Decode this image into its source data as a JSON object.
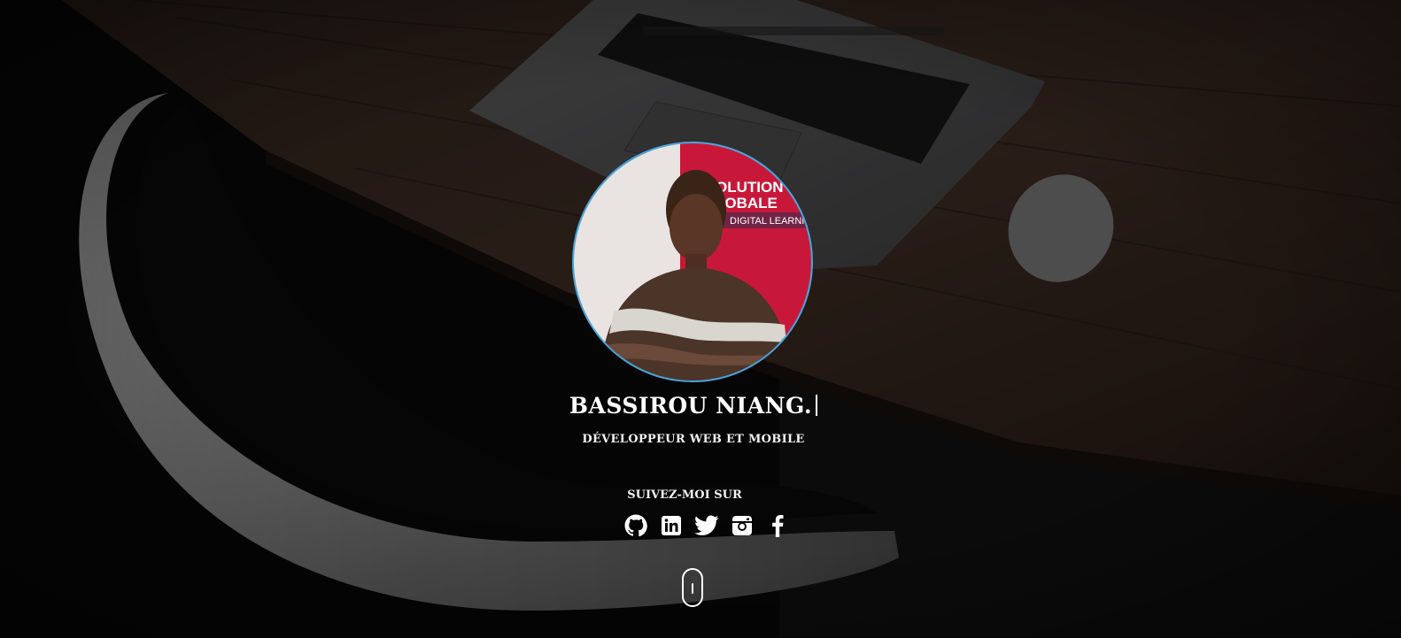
{
  "hero": {
    "name": "BASSIROU NIANG.",
    "role": "DÉVELOPPEUR WEB ET MOBILE",
    "follow_label": "SUIVEZ-MOI SUR"
  },
  "avatar": {
    "banner_line1": "OLUTION",
    "banner_line2": "LOBALE",
    "banner_line3": "DIGITAL LEARNING",
    "accent_color": "#3fa9e0",
    "banner_color": "#c8183a"
  },
  "socials": [
    {
      "icon": "github-icon"
    },
    {
      "icon": "linkedin-icon"
    },
    {
      "icon": "twitter-icon"
    },
    {
      "icon": "instagram-icon"
    },
    {
      "icon": "facebook-icon"
    }
  ],
  "colors": {
    "text": "#ffffff",
    "avatar_border": "#3fa9e0",
    "background": "#0b0b0b"
  }
}
